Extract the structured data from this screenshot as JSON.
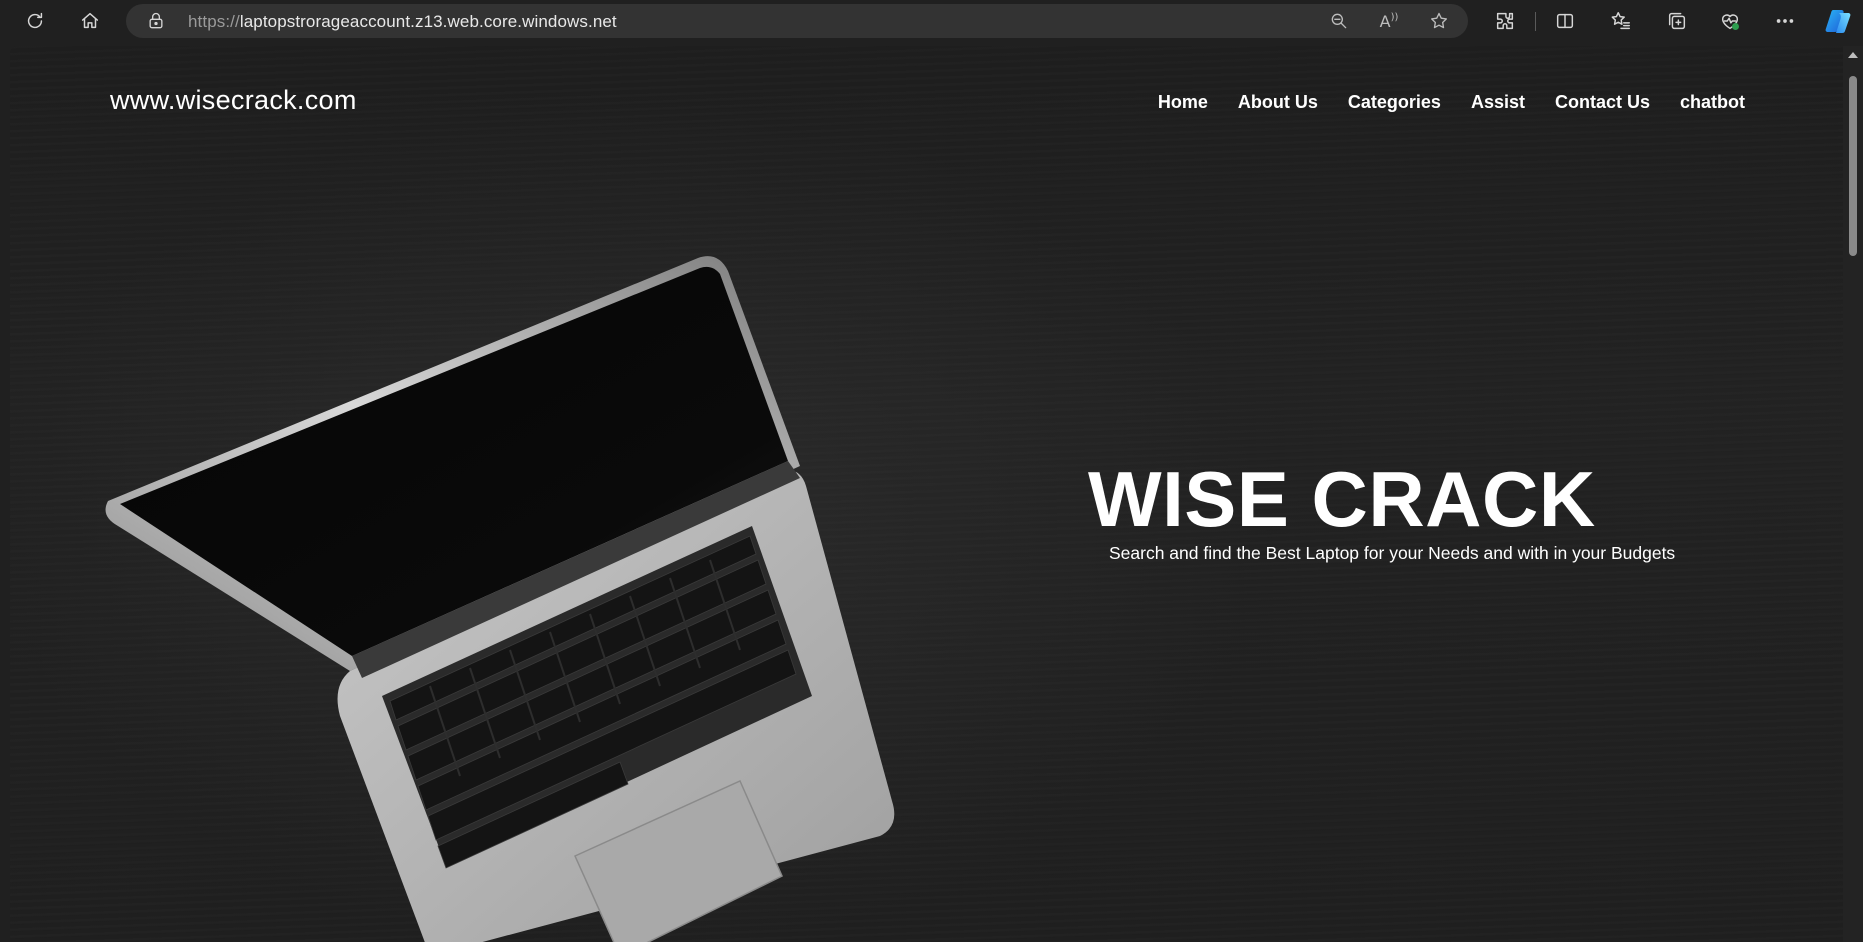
{
  "browser": {
    "url_scheme": "https://",
    "url_host": "laptopstrorageaccount.z13.web.core.windows.net",
    "toolbar_icons": [
      "refresh-icon",
      "home-icon",
      "lock-icon",
      "zoom-out-icon",
      "read-aloud-icon",
      "favorite-star-icon",
      "extensions-icon",
      "split-screen-icon",
      "favorites-icon",
      "collections-icon",
      "browser-essentials-icon",
      "more-icon",
      "copilot-icon"
    ],
    "read_aloud_glyph": "A"
  },
  "site": {
    "logo": "www.wisecrack.com",
    "nav": [
      {
        "label": "Home"
      },
      {
        "label": "About Us"
      },
      {
        "label": "Categories"
      },
      {
        "label": "Assist"
      },
      {
        "label": "Contact Us"
      },
      {
        "label": "chatbot"
      }
    ],
    "hero": {
      "title": "WISE CRACK",
      "subtitle": "Search and find the Best Laptop for your Needs and with in your Budgets"
    }
  },
  "colors": {
    "background": "#1e1e1e",
    "text": "#ffffff",
    "browser_chrome": "#202020"
  }
}
